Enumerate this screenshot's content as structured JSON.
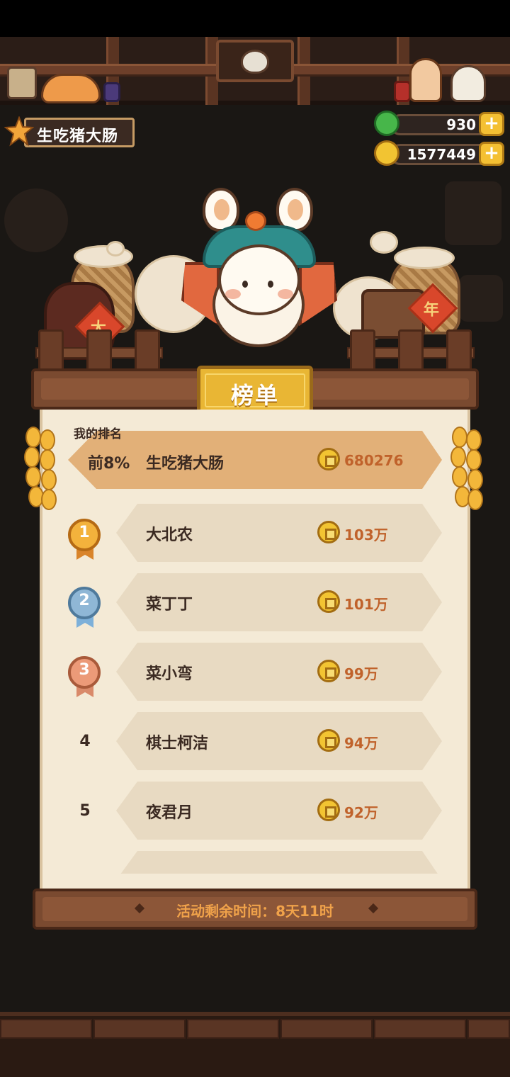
{
  "player": {
    "name": "生吃猪大肠"
  },
  "currency": {
    "gems": "930",
    "coins": "1577449"
  },
  "board": {
    "title": "榜单",
    "my_rank_label": "我的排名",
    "my_rank": {
      "rank": "前8%",
      "name": "生吃猪大肠",
      "score": "680276"
    },
    "entries": [
      {
        "rank": "1",
        "name": "大北农",
        "score": "103万"
      },
      {
        "rank": "2",
        "name": "菜丁丁",
        "score": "101万"
      },
      {
        "rank": "3",
        "name": "菜小弯",
        "score": "99万"
      },
      {
        "rank": "4",
        "name": "棋士柯洁",
        "score": "94万"
      },
      {
        "rank": "5",
        "name": "夜君月",
        "score": "92万"
      }
    ],
    "timer": "活动剩余时间：8天11时"
  },
  "scene": {
    "tag_left": "大",
    "tag_right": "年"
  },
  "colors": {
    "gold": "#e9b634",
    "score": "#c0622b",
    "parchment": "#f4ead6",
    "wood": "#7a4a30"
  },
  "icons": [
    "gem-icon",
    "coin-icon",
    "plus-icon",
    "medal-icon",
    "corn-icon"
  ]
}
